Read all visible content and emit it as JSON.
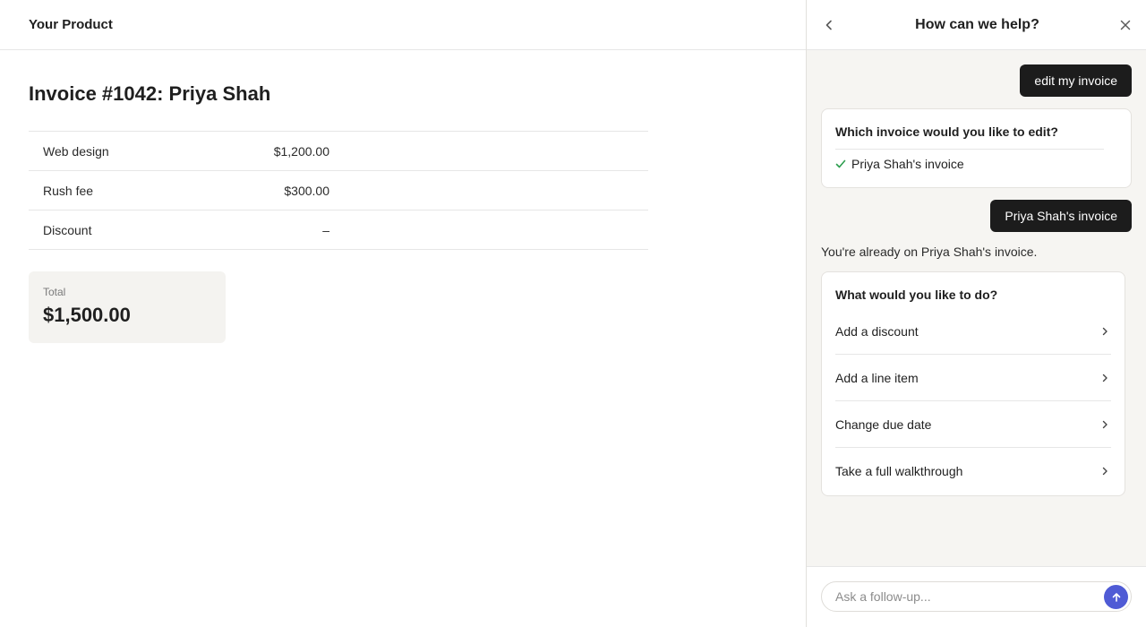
{
  "app": {
    "brand": "Your Product"
  },
  "invoice": {
    "title": "Invoice #1042: Priya Shah",
    "lines": [
      {
        "description": "Web design",
        "amount": "$1,200.00"
      },
      {
        "description": "Rush fee",
        "amount": "$300.00"
      },
      {
        "description": "Discount",
        "amount": "–"
      }
    ],
    "total_label": "Total",
    "total_value": "$1,500.00"
  },
  "help_panel": {
    "title": "How can we help?",
    "icons": {
      "back": "chevron-left-icon",
      "close": "close-icon",
      "check": "check-icon",
      "chevron": "chevron-right-icon",
      "send": "arrow-up-icon"
    },
    "messages": {
      "user_1": "edit my invoice",
      "question_1": "Which invoice would you like to edit?",
      "answer_1": "Priya Shah's invoice",
      "user_2": "Priya Shah's invoice",
      "assistant_1": "You're already on Priya Shah's invoice."
    },
    "actions_card": {
      "title": "What would you like to do?",
      "options": [
        "Add a discount",
        "Add a line item",
        "Change due date",
        "Take a full walkthrough"
      ]
    },
    "composer": {
      "placeholder": "Ask a follow-up..."
    },
    "colors": {
      "accent": "#4f5bd5",
      "check": "#2e9e4f",
      "user_bubble": "#1c1c1c"
    }
  }
}
